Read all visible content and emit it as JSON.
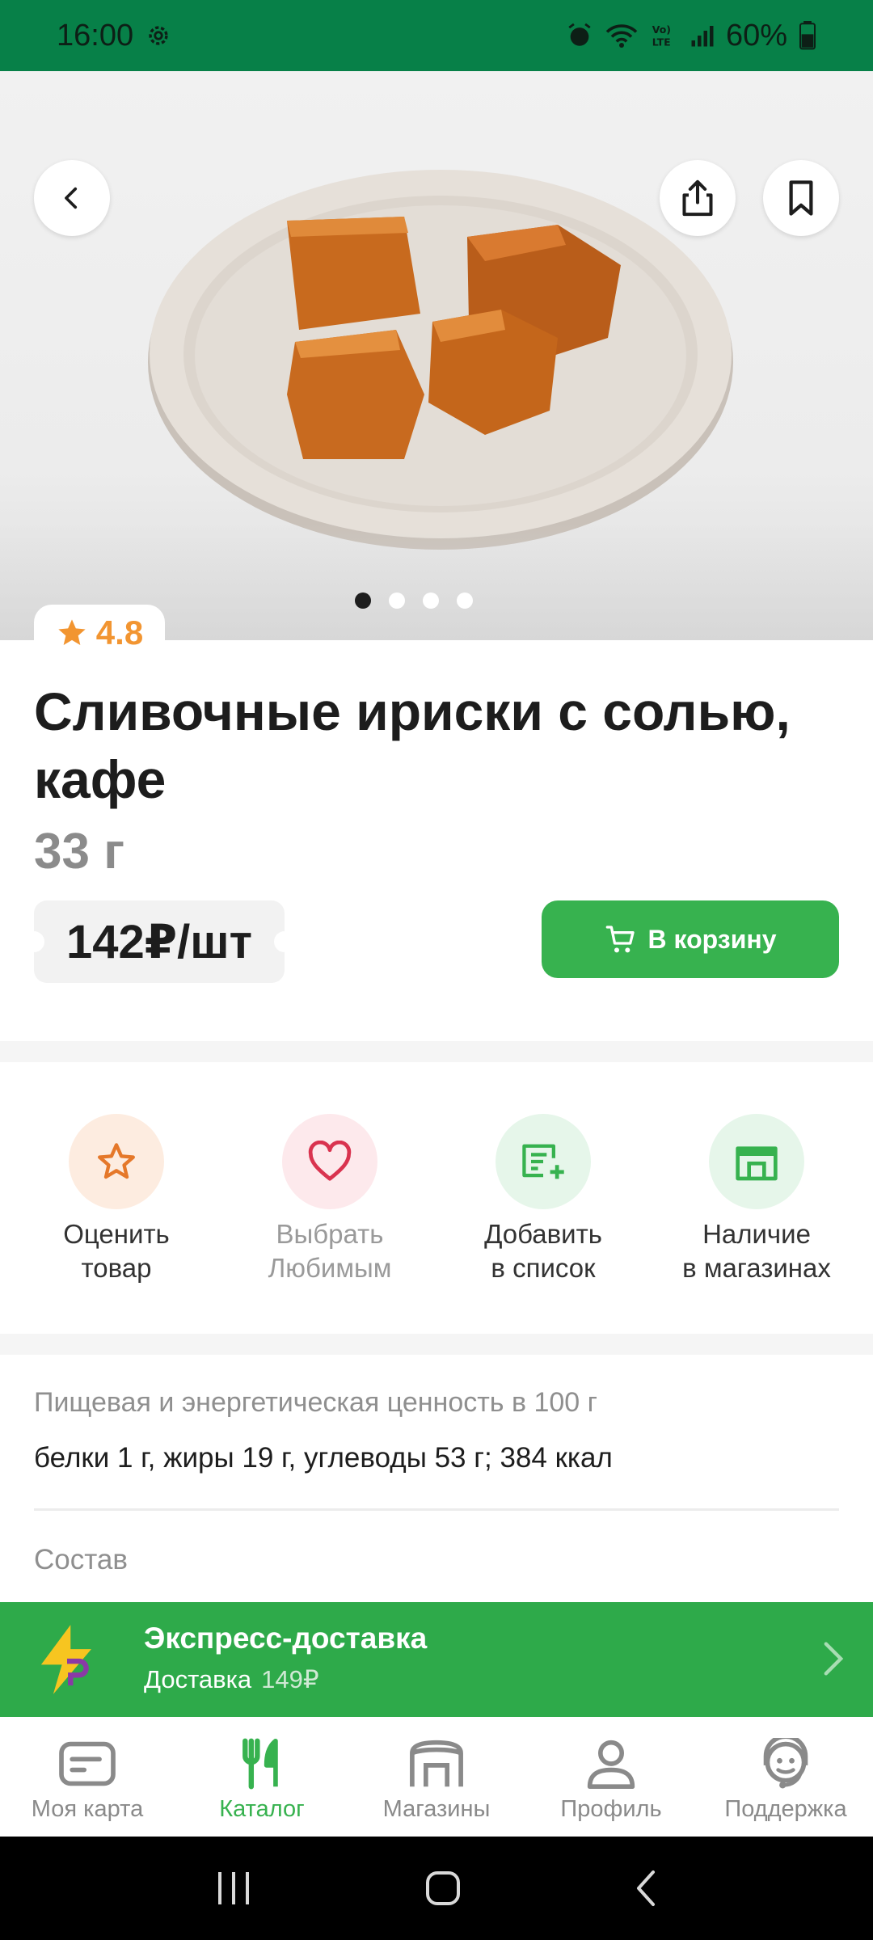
{
  "status_bar": {
    "time": "16:00",
    "battery": "60%"
  },
  "product": {
    "rating": "4.8",
    "title": "Сливочные ириски с солью, кафе",
    "weight": "33 г",
    "price": "142₽/шт",
    "cart_button": "В корзину"
  },
  "gallery": {
    "count": 4,
    "active_index": 0
  },
  "actions": [
    {
      "label": "Оценить\nтовар",
      "icon": "star-icon"
    },
    {
      "label": "Выбрать\nЛюбимым",
      "icon": "heart-icon"
    },
    {
      "label": "Добавить\nв список",
      "icon": "add-list-icon"
    },
    {
      "label": "Наличие\nв магазинах",
      "icon": "store-icon"
    }
  ],
  "nutrition": {
    "label": "Пищевая и энергетическая ценность в 100 г",
    "value": "белки 1 г, жиры 19 г, углеводы 53 г; 384 ккал"
  },
  "composition": {
    "label": "Состав"
  },
  "express": {
    "title": "Экспресс-доставка",
    "subtitle": "Доставка",
    "price": "149₽"
  },
  "bottom_nav": [
    {
      "label": "Моя карта",
      "icon": "card-icon"
    },
    {
      "label": "Каталог",
      "icon": "fork-knife-icon",
      "active": true
    },
    {
      "label": "Магазины",
      "icon": "store-icon"
    },
    {
      "label": "Профиль",
      "icon": "user-icon"
    },
    {
      "label": "Поддержка",
      "icon": "support-icon"
    }
  ],
  "colors": {
    "brand_green": "#37b24f",
    "status_green": "#078048",
    "rating_orange": "#f29531"
  }
}
